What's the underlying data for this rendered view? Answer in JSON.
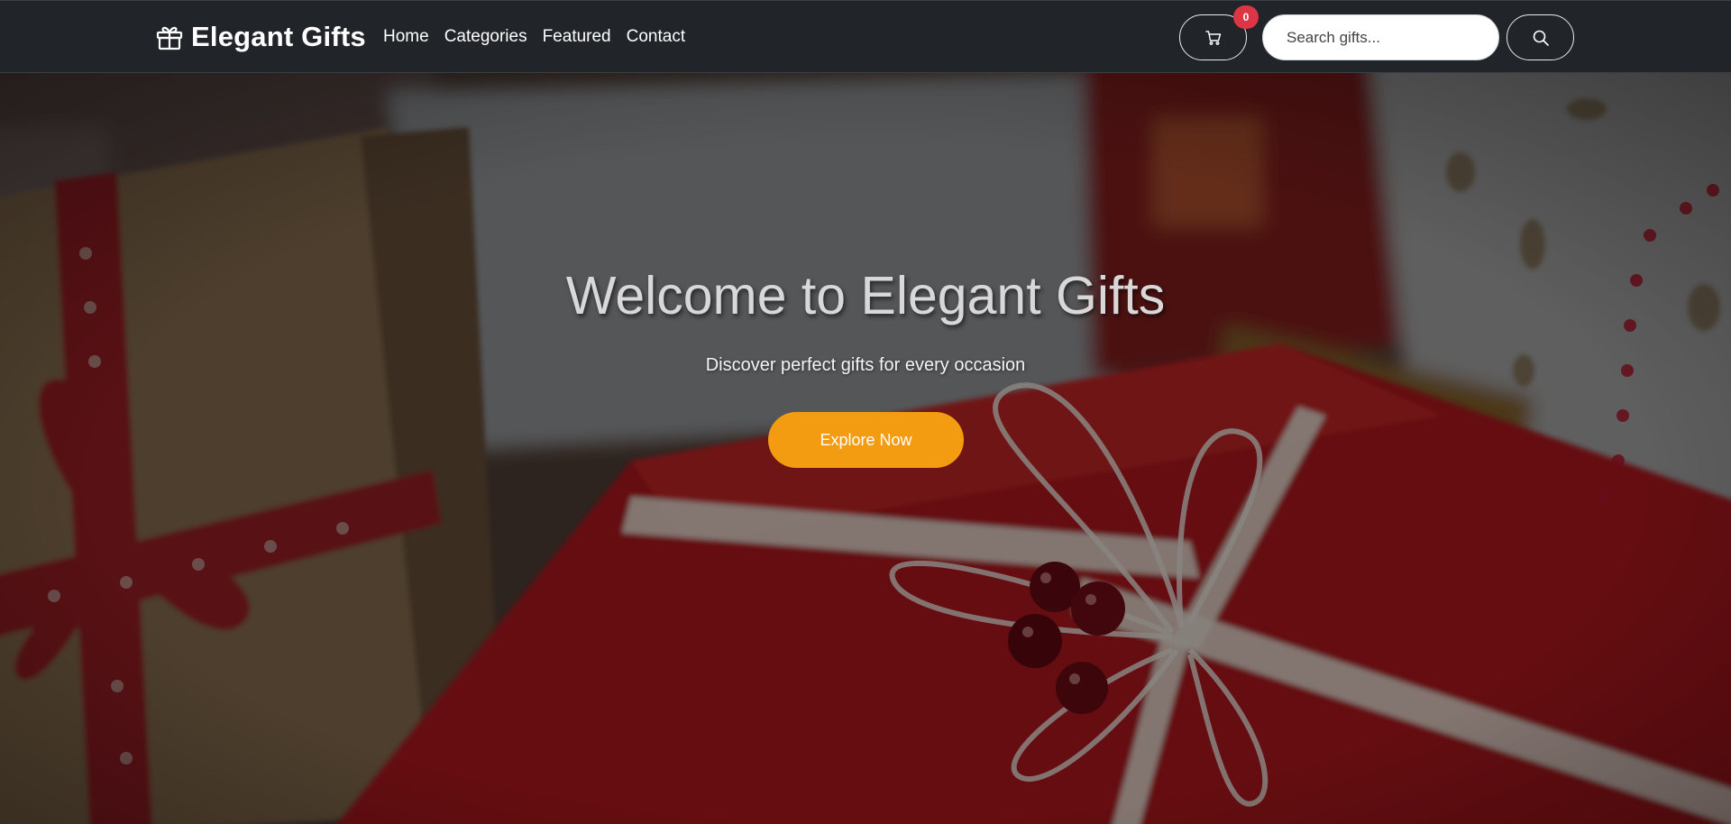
{
  "brand": {
    "name": "Elegant Gifts",
    "icon": "gift-icon"
  },
  "nav": {
    "links": [
      {
        "label": "Home"
      },
      {
        "label": "Categories"
      },
      {
        "label": "Featured"
      },
      {
        "label": "Contact"
      }
    ]
  },
  "cart": {
    "icon": "cart-icon",
    "count": "0"
  },
  "search": {
    "placeholder": "Search gifts...",
    "value": "",
    "icon": "search-icon"
  },
  "hero": {
    "title": "Welcome to Elegant Gifts",
    "subtitle": "Discover perfect gifts for every occasion",
    "cta_label": "Explore Now"
  },
  "colors": {
    "navbar_bg": "#212529",
    "accent": "#f39c12",
    "badge": "#dc3545"
  }
}
